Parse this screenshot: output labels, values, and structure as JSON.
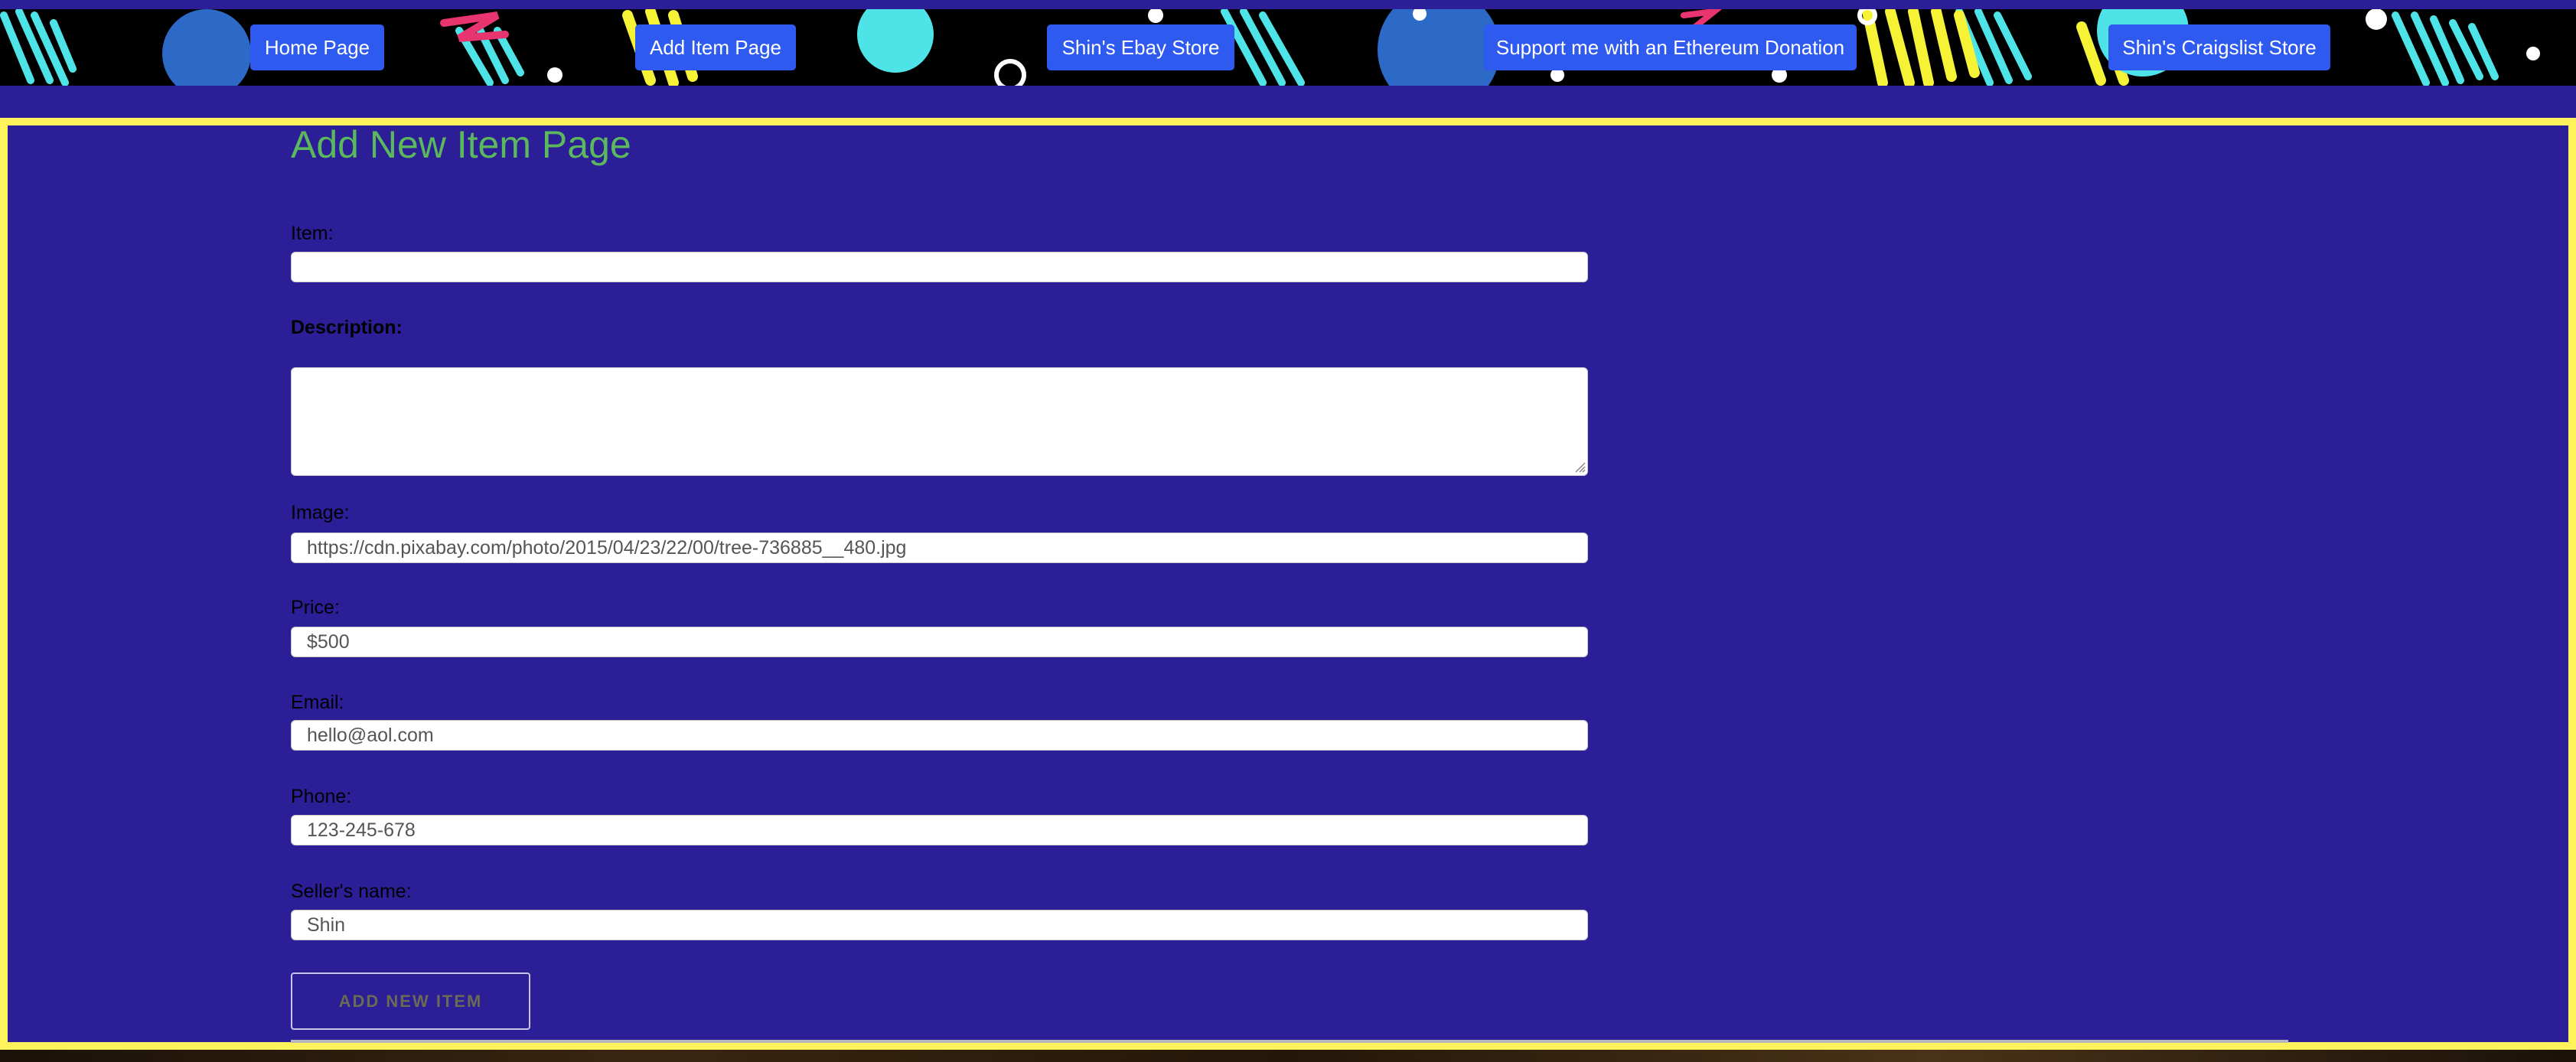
{
  "nav": {
    "home": "Home Page",
    "add_item": "Add Item Page",
    "ebay": "Shin's Ebay Store",
    "donate": "Support me with an Ethereum Donation",
    "craigslist": "Shin's Craigslist Store"
  },
  "page": {
    "title": "Add New Item Page"
  },
  "form": {
    "item_label": "Item:",
    "item_value": "",
    "description_label": "Description:",
    "description_value": "",
    "image_label": "Image:",
    "image_value": "https://cdn.pixabay.com/photo/2015/04/23/22/00/tree-736885__480.jpg",
    "price_label": "Price:",
    "price_value": "$500",
    "email_label": "Email:",
    "email_value": "hello@aol.com",
    "phone_label": "Phone:",
    "phone_value": "123-245-678",
    "seller_label": "Seller's name:",
    "seller_value": "Shin",
    "submit_label": "ADD NEW ITEM"
  },
  "colors": {
    "page_background": "#2b1e97",
    "border_yellow": "#fef35a",
    "nav_button": "#2f5af0",
    "title_green": "#5cb85c"
  },
  "icons": {
    "textarea_resize": "resize-grip-icon"
  }
}
